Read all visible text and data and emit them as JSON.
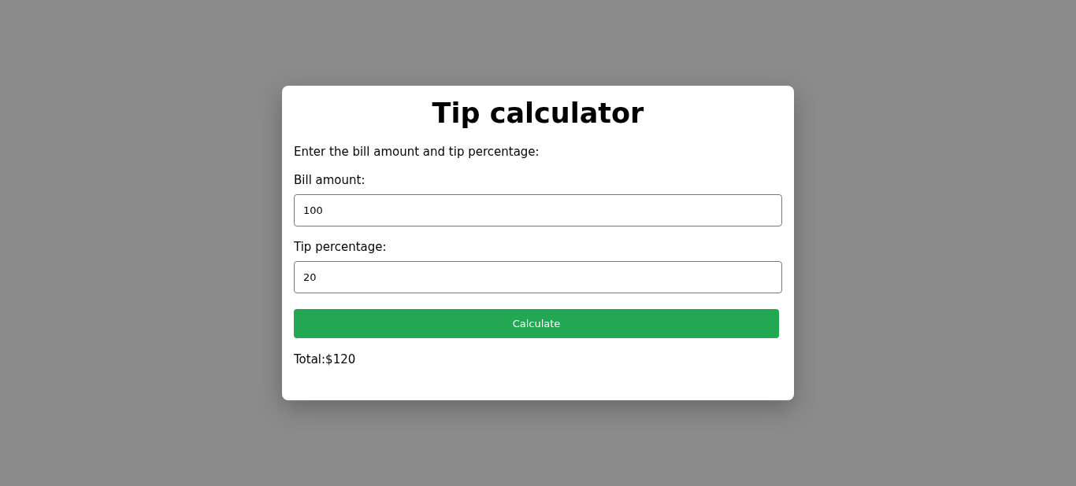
{
  "title": "Tip calculator",
  "instructions": "Enter the bill amount and tip percentage:",
  "fields": [
    {
      "label": "Bill amount:",
      "value": "100"
    },
    {
      "label": "Tip percentage:",
      "value": "20"
    }
  ],
  "button": "Calculate",
  "result": "Total:$120"
}
